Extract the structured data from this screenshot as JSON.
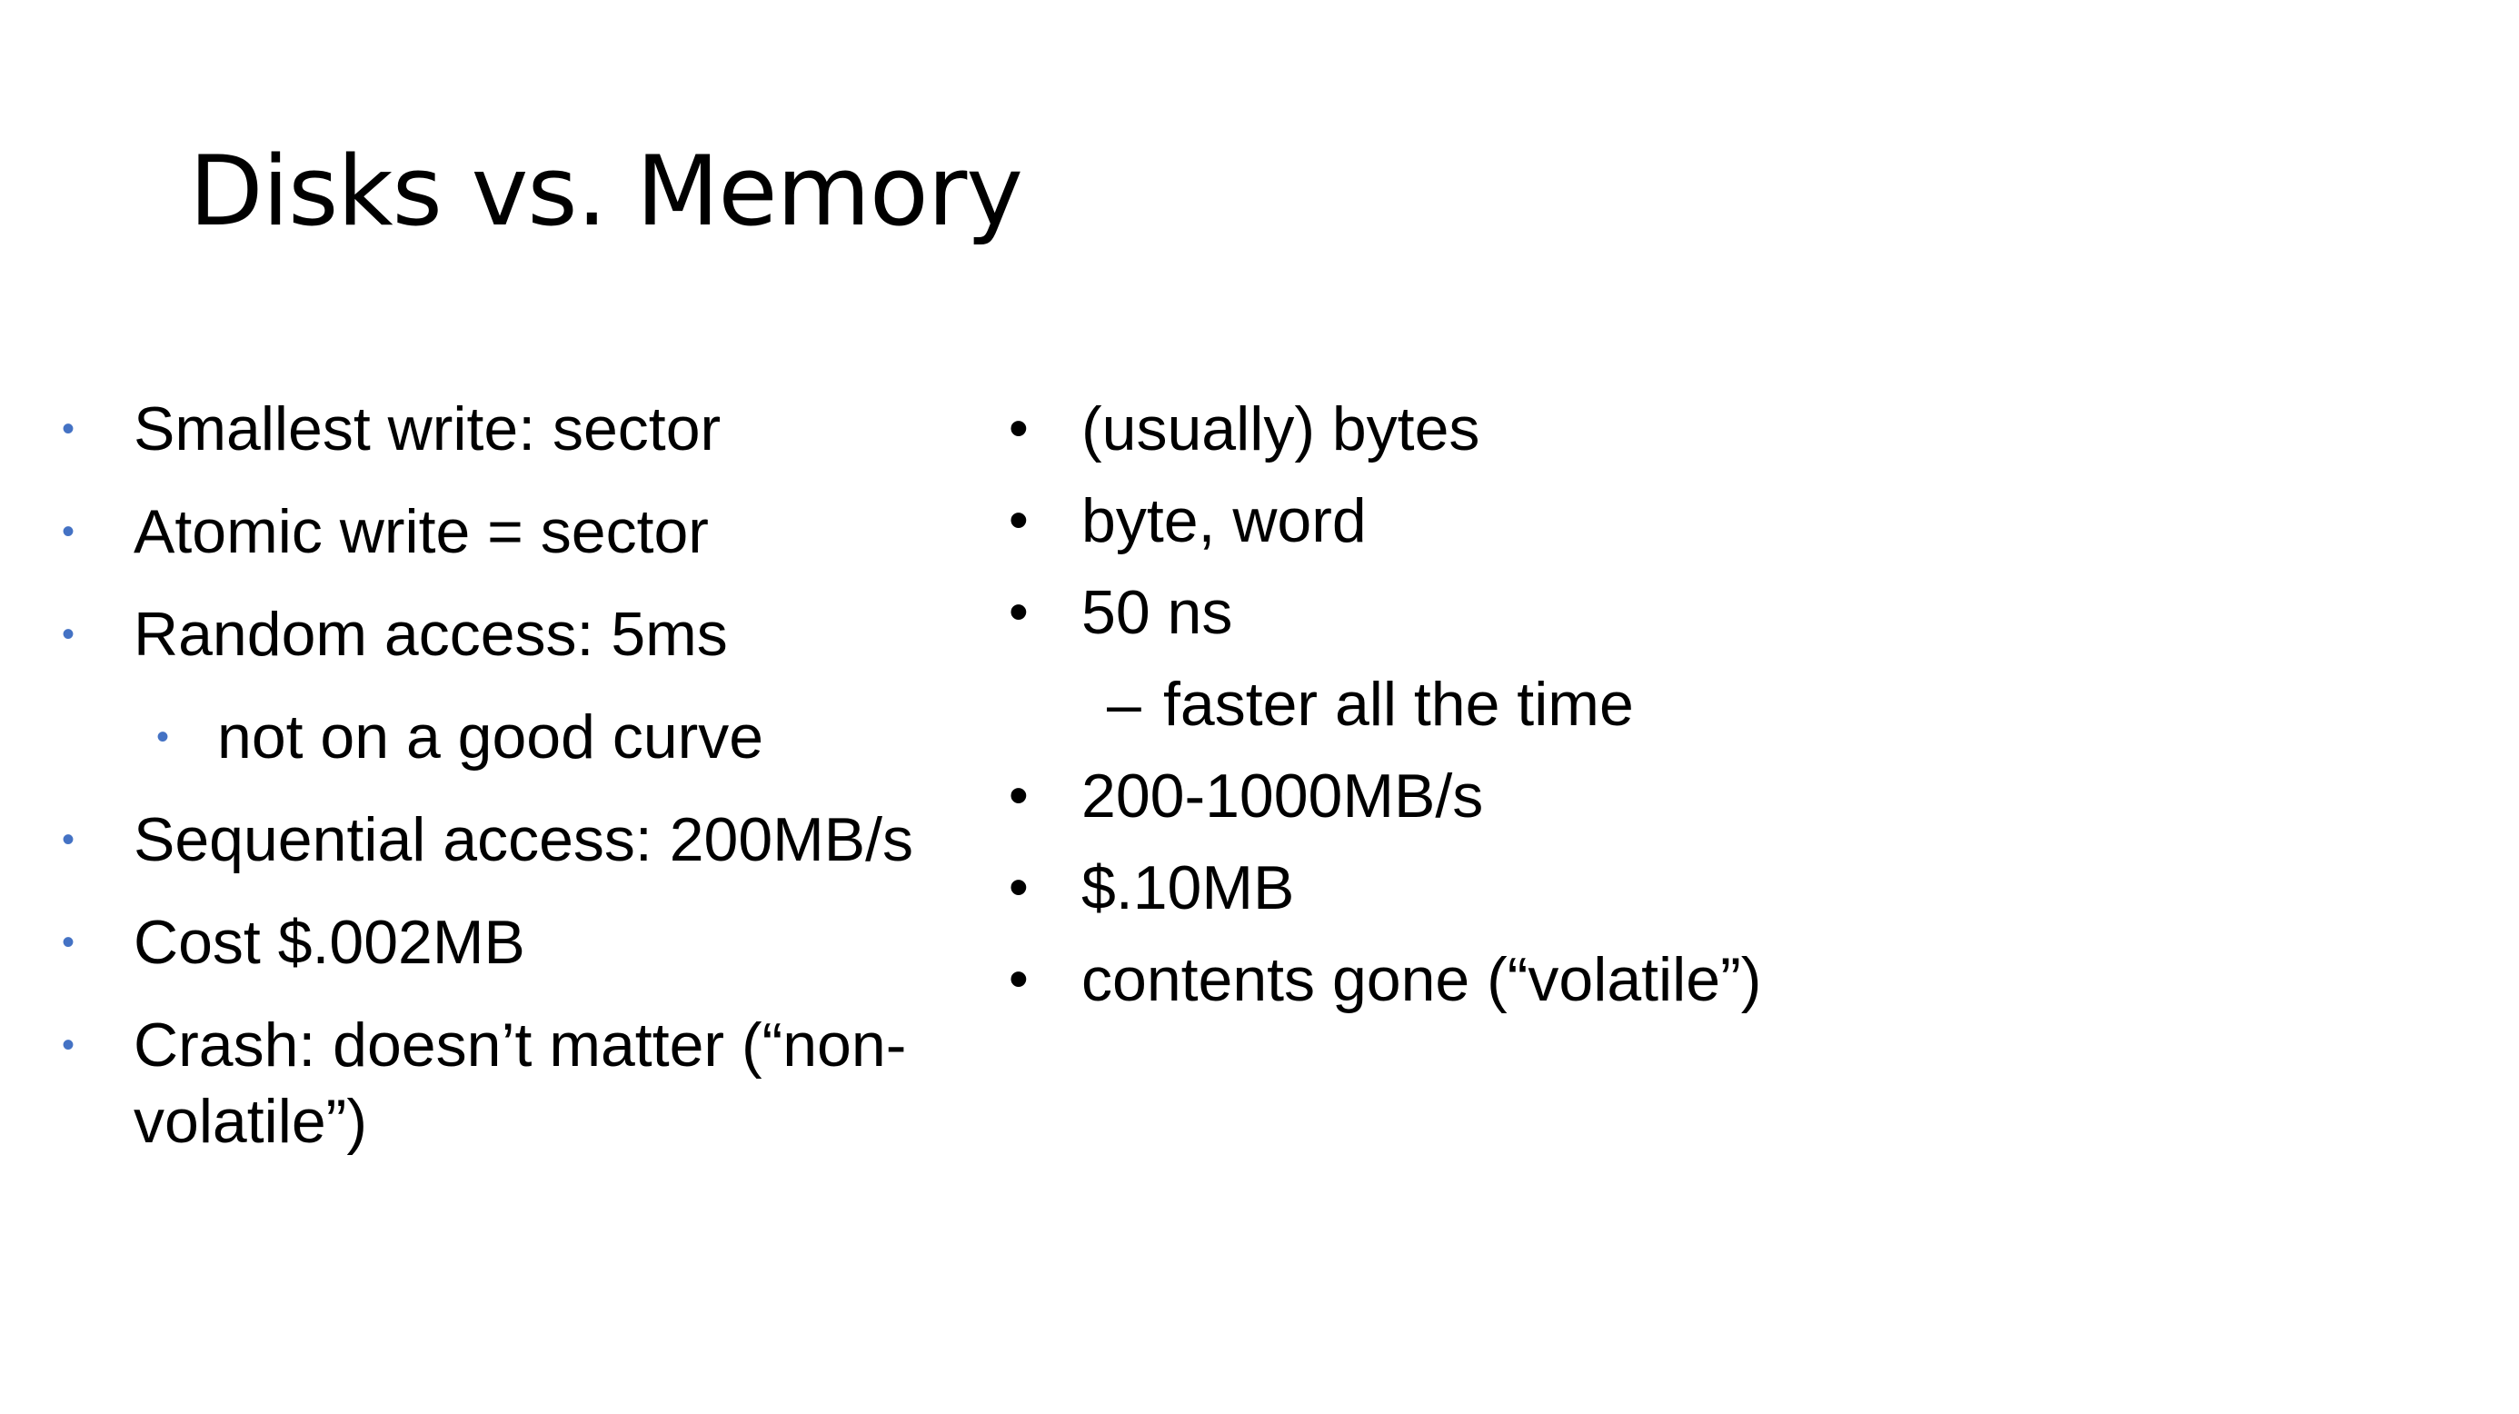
{
  "slide": {
    "title": "Disks vs. Memory",
    "accent_color": "#4472c4",
    "disks": {
      "items": [
        {
          "level": 1,
          "bullet": "•",
          "text": "Smallest write: sector"
        },
        {
          "level": 1,
          "bullet": "•",
          "text": "Atomic write = sector"
        },
        {
          "level": 1,
          "bullet": "•",
          "text": "Random access: 5ms"
        },
        {
          "level": 2,
          "bullet": "•",
          "text": "not on a good curve"
        },
        {
          "level": 1,
          "bullet": "•",
          "text": "Sequential access: 200MB/s"
        },
        {
          "level": 1,
          "bullet": "•",
          "text": "Cost $.002MB"
        },
        {
          "level": 1,
          "bullet": "•",
          "text": "Crash: doesn’t matter (“non-volatile”)"
        }
      ]
    },
    "memory": {
      "items": [
        {
          "level": 1,
          "bullet": "•",
          "text": "(usually) bytes"
        },
        {
          "level": 1,
          "bullet": "•",
          "text": "byte, word"
        },
        {
          "level": 1,
          "bullet": "•",
          "text": "50 ns"
        },
        {
          "level": 2,
          "bullet": "–",
          "text": "faster all the time"
        },
        {
          "level": 1,
          "bullet": "•",
          "text": "200-1000MB/s"
        },
        {
          "level": 1,
          "bullet": "•",
          "text": "$.10MB"
        },
        {
          "level": 1,
          "bullet": "•",
          "text": "contents gone (“volatile”)"
        }
      ]
    }
  }
}
